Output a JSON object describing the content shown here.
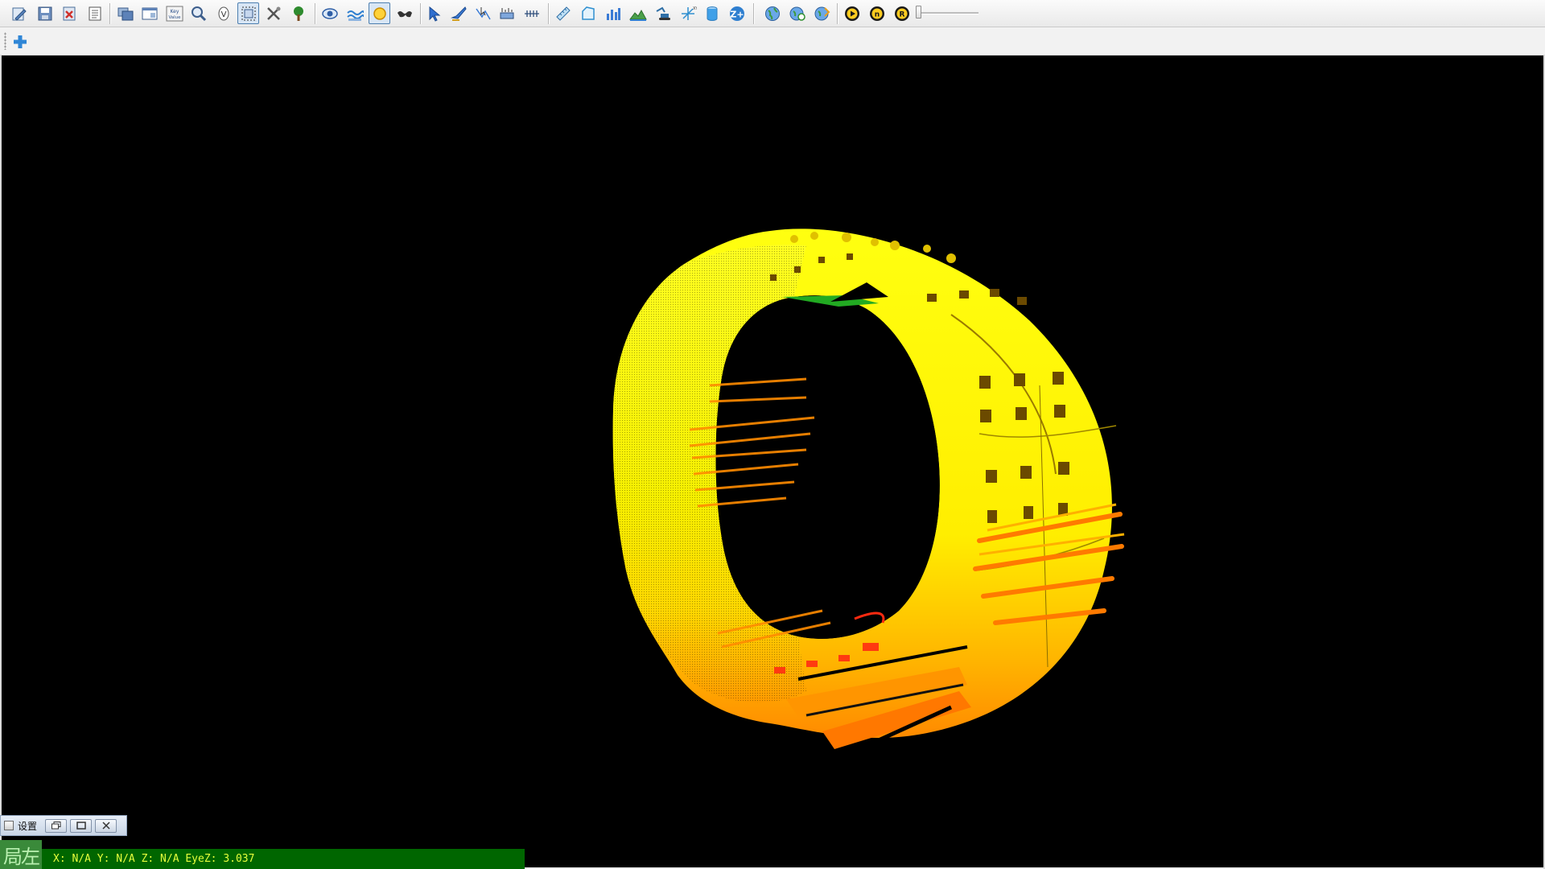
{
  "toolbar": {
    "icons": [
      "edit-pencil-icon",
      "save-icon",
      "close-file-icon",
      "document-list-icon",
      "layer-stack-icon",
      "window-icon",
      "key-value-icon",
      "zoom-search-icon",
      "v-mode-icon",
      "select-frame-icon",
      "tools-icon",
      "tree-icon",
      "eye-icon",
      "water-icon",
      "sun-icon",
      "glasses-icon",
      "pointer-arrow-icon",
      "pen-select-icon",
      "polyline-select-icon",
      "axis-ruler-icon",
      "grid-marks-icon",
      "ruler-icon",
      "shape-icon",
      "bar-chart-icon",
      "terrain-icon",
      "excavator-icon",
      "xyz-axis-icon",
      "cylinder-icon",
      "zoom-plus-icon",
      "globe-icon",
      "globe-refresh-icon",
      "globe-settings-icon",
      "media-play-icon",
      "media-n-icon",
      "media-r-icon"
    ],
    "active_icons": [
      "select-frame-icon",
      "sun-icon"
    ],
    "key_value_text": "Key Value"
  },
  "toolbar2": {
    "add_icon": "add-cross-icon"
  },
  "mini_panel": {
    "label": "设置",
    "buttons": [
      "restore-icon",
      "maximize-icon",
      "close-icon"
    ]
  },
  "status": {
    "left_badge": "局左",
    "coords": "X: N/A Y: N/A Z: N/A EyeZ: 3.037"
  },
  "viewport": {
    "background": "#000000",
    "colors": {
      "yellow": "#ffff00",
      "orange": "#ff9900",
      "red": "#ff3300",
      "green": "#33cc33"
    }
  }
}
